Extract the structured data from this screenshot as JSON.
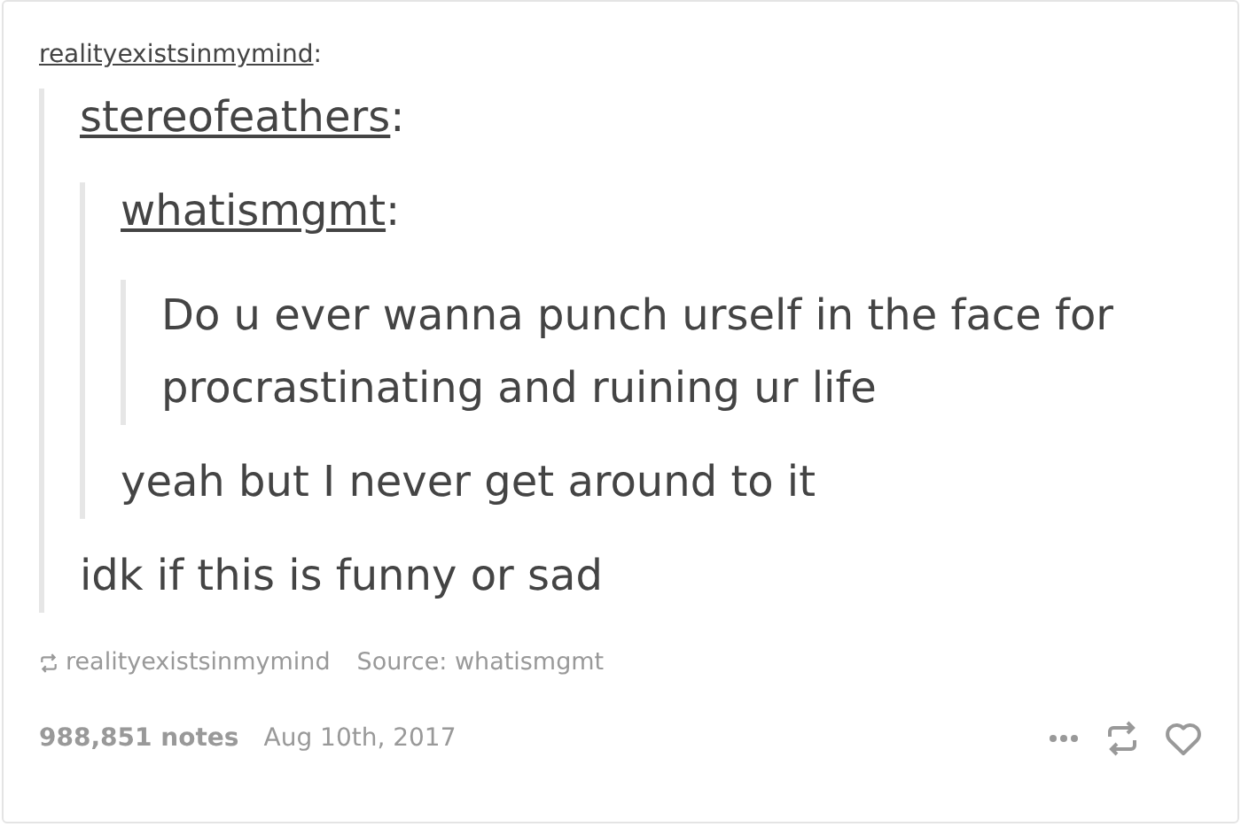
{
  "post": {
    "user": "realityexistsinmymind",
    "suffix": ":",
    "quote": {
      "user": "stereofeathers",
      "suffix": ":",
      "quote": {
        "user": "whatismgmt",
        "suffix": ":",
        "quote": {
          "body": "Do u ever wanna punch urself in the face for procrastinating and ruining ur life"
        },
        "body": "yeah but I never get around to it"
      },
      "body": "idk if this is funny or sad"
    }
  },
  "attribution": {
    "reblogged_from": "realityexistsinmymind",
    "source": "Source: whatismgmt"
  },
  "footer": {
    "notes": "988,851 notes",
    "date": "Aug 10th, 2017"
  }
}
